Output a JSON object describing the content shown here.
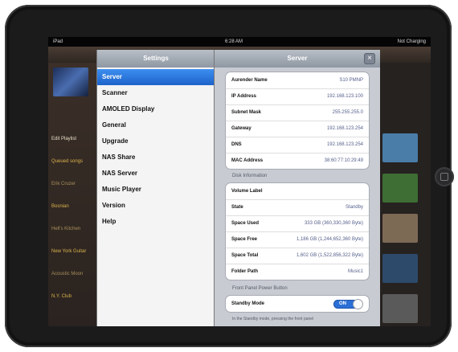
{
  "status_bar": {
    "carrier": "iPad",
    "time": "6:28 AM",
    "battery_text": "Not Charging"
  },
  "settings_panel": {
    "title": "Settings",
    "items": [
      {
        "label": "Server",
        "selected": true
      },
      {
        "label": "Scanner"
      },
      {
        "label": "AMOLED Display"
      },
      {
        "label": "General"
      },
      {
        "label": "Upgrade"
      },
      {
        "label": "NAS Share"
      },
      {
        "label": "NAS Server"
      },
      {
        "label": "Music Player"
      },
      {
        "label": "Version"
      },
      {
        "label": "Help"
      }
    ]
  },
  "server_panel": {
    "title": "Server",
    "network": [
      {
        "label": "Aurender Name",
        "value": "S10 PMNP"
      },
      {
        "label": "IP Address",
        "value": "192.168.123.100"
      },
      {
        "label": "Subnet Mask",
        "value": "255.255.255.0"
      },
      {
        "label": "Gateway",
        "value": "192.168.123.254"
      },
      {
        "label": "DNS",
        "value": "192.168.123.254"
      },
      {
        "label": "MAC Address",
        "value": "38:60:77:10:29:49"
      }
    ],
    "disk_section_title": "Disk Information",
    "disk": [
      {
        "label": "Volume Label",
        "value": ""
      },
      {
        "label": "State",
        "value": "Standby"
      },
      {
        "label": "Space Used",
        "value": "333 GB (360,330,360 Byte)"
      },
      {
        "label": "Space Free",
        "value": "1,186 GB (1,244,652,360 Byte)"
      },
      {
        "label": "Space Total",
        "value": "1,602 GB (1,522,856,322 Byte)"
      },
      {
        "label": "Folder Path",
        "value": "Music1"
      }
    ],
    "power_section_title": "Front Panel Power Button",
    "standby": {
      "label": "Standby Mode",
      "toggle": "ON"
    },
    "footnote": "In the Standby mode, pressing the front panel"
  },
  "background": {
    "left_items": [
      "Edit Playlist",
      "Queued songs",
      "Erik Cruzer",
      "Bosnian",
      "Hell's Kitchen",
      "New York Guitar",
      "Acoustic Moon",
      "N.Y. Club"
    ],
    "left_item_colors": [
      "#e8e0c8",
      "#d9b24a",
      "#a88f5a",
      "#d9b24a",
      "#a88f5a",
      "#d9b24a",
      "#a88f5a",
      "#d9b24a"
    ],
    "thumb_colors": [
      "#4a7da8",
      "#3e6e33",
      "#7d6a55",
      "#2d4a6a",
      "#5a5a5a"
    ]
  }
}
